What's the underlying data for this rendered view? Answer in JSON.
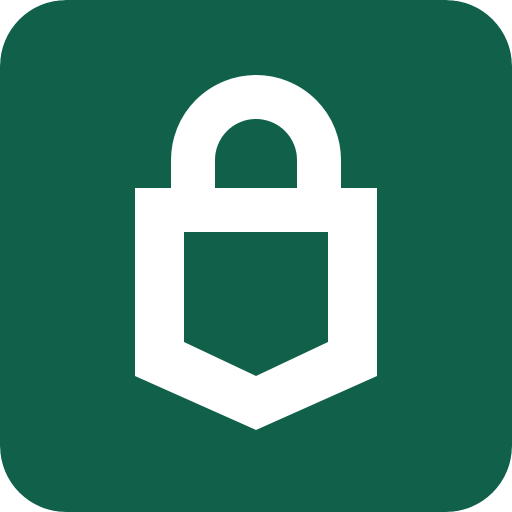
{
  "app_icon": {
    "icon": "lock-shield-icon",
    "background_color": "#11614A",
    "glyph_color": "#FFFFFF"
  }
}
